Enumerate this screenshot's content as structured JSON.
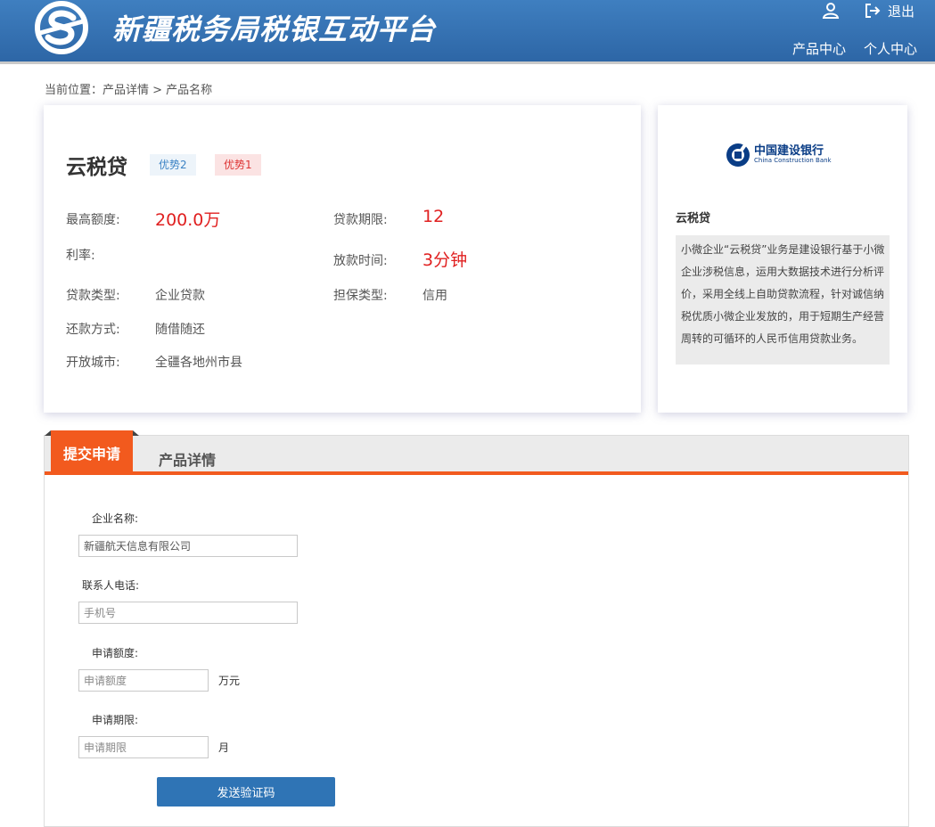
{
  "header": {
    "site_title": "新疆税务局税银互动平台",
    "logout_label": "退出",
    "nav": [
      "产品中心",
      "个人中心"
    ]
  },
  "breadcrumb": "当前位置：产品详情 > 产品名称",
  "product": {
    "name": "云税贷",
    "tags": [
      "优势2",
      "优势1"
    ],
    "max_amount_label": "最高额度:",
    "max_amount_value": "200.0万",
    "term_label": "贷款期限:",
    "term_value": "12",
    "rate_label": "利率:",
    "rate_value": "",
    "disburse_label": "放款时间:",
    "disburse_value": "3分钟",
    "loan_type_label": "贷款类型:",
    "loan_type_value": "企业贷款",
    "guarantee_label": "担保类型:",
    "guarantee_value": "信用",
    "repay_label": "还款方式:",
    "repay_value": "随借随还",
    "cities_label": "开放城市:",
    "cities_value": "全疆各地州市县"
  },
  "side": {
    "bank_name_cn": "中国建设银行",
    "bank_name_en": "China Construction Bank",
    "title": "云税贷",
    "description": "小微企业“云税贷”业务是建设银行基于小微企业涉税信息，运用大数据技术进行分析评价，采用全线上自助贷款流程，针对诚信纳税优质小微企业发放的，用于短期生产经营周转的可循环的人民币信用贷款业务。"
  },
  "tabs": {
    "active": "提交申请",
    "other": "产品详情"
  },
  "form": {
    "company_label": "企业名称:",
    "company_value": "新疆航天信息有限公司",
    "phone_label": "联系人电话:",
    "phone_placeholder": "手机号",
    "amount_label": "申请额度:",
    "amount_placeholder": "申请额度",
    "amount_unit": "万元",
    "term_label": "申请期限:",
    "term_placeholder": "申请期限",
    "term_unit": "月",
    "send_code_label": "发送验证码"
  },
  "colors": {
    "header": "#3570b0",
    "accent": "#f25a1e",
    "highlight_red": "#e02020",
    "button_blue": "#2f74b5"
  }
}
